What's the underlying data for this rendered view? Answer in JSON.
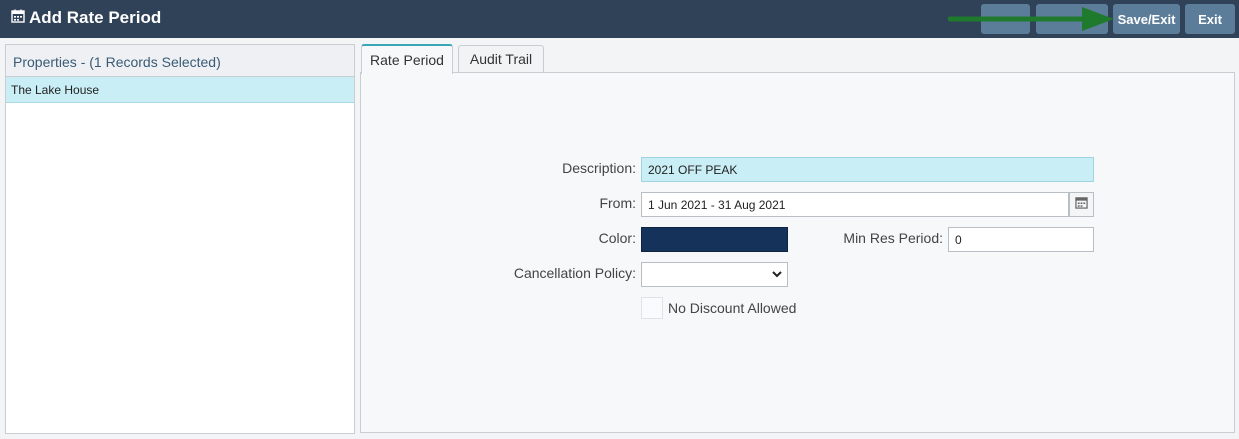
{
  "window": {
    "title": "Add Rate Period",
    "icon": "calendar-icon"
  },
  "toolbar": {
    "save_exit_label": "Save/Exit",
    "exit_label": "Exit"
  },
  "properties_panel": {
    "header": "Properties - (1 Records Selected)",
    "items": [
      {
        "label": "The Lake House",
        "selected": true
      }
    ]
  },
  "tabs": [
    {
      "label": "Rate Period",
      "active": true
    },
    {
      "label": "Audit Trail",
      "active": false
    }
  ],
  "form": {
    "description_label": "Description:",
    "description_value": "2021 OFF PEAK",
    "from_label": "From:",
    "from_value": "1 Jun 2021 - 31 Aug 2021",
    "color_label": "Color:",
    "color_value": "#15325a",
    "min_res_label": "Min Res Period:",
    "min_res_value": "0",
    "cancellation_label": "Cancellation Policy:",
    "cancellation_value": "",
    "no_discount_label": "No Discount Allowed",
    "no_discount_checked": false
  },
  "colors": {
    "titlebar": "#2f4258",
    "button": "#5c7d99",
    "selected_row": "#c9eef5",
    "arrow": "#1f7a2e"
  }
}
